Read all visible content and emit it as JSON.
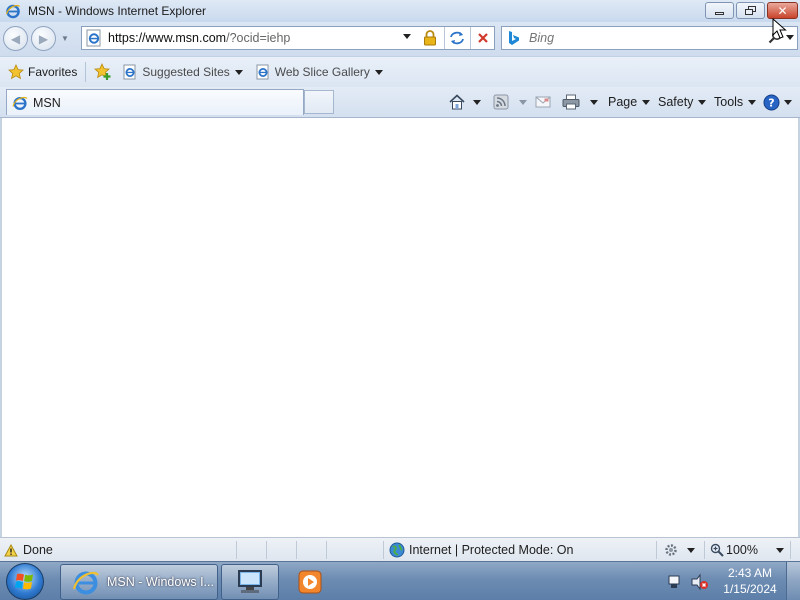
{
  "window": {
    "title": "MSN - Windows Internet Explorer",
    "controls": {
      "minimize": "▭",
      "restore": "⧉",
      "close": "✕"
    }
  },
  "nav": {
    "back_icon": "back-arrow-icon",
    "forward_icon": "forward-arrow-icon",
    "address": {
      "url_main": "https://www.msn.com",
      "url_rest": "/?ocid=iehp"
    },
    "search": {
      "provider_icon": "bing-icon",
      "placeholder": "Bing"
    }
  },
  "favorites_bar": {
    "favorites_label": "Favorites",
    "items": [
      {
        "label": "Suggested Sites",
        "icon": "ie-page-icon"
      },
      {
        "label": "Web Slice Gallery",
        "icon": "ie-page-icon"
      }
    ]
  },
  "tabs": {
    "active": {
      "label": "MSN",
      "icon": "ie-page-icon"
    }
  },
  "command_bar": {
    "page_label": "Page",
    "safety_label": "Safety",
    "tools_label": "Tools"
  },
  "status": {
    "text": "Done",
    "zone": "Internet | Protected Mode: On",
    "zoom": "100%"
  },
  "taskbar": {
    "ie_button_label": "MSN - Windows I...",
    "time": "2:43 AM",
    "date": "1/15/2024"
  },
  "colors": {
    "chrome_blue": "#d4e0ef",
    "close_red": "#c9442b",
    "taskbar_blue": "#6d8cb2",
    "link_blue": "#1f5fb4"
  }
}
